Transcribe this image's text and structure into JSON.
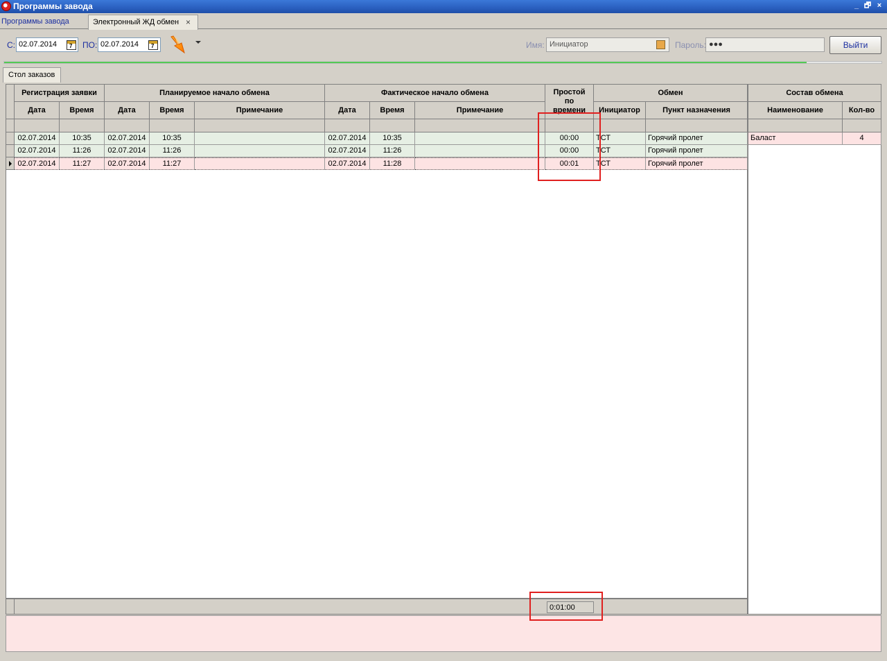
{
  "window": {
    "title": "Программы завода",
    "controls": [
      "_",
      "🗗",
      "×"
    ]
  },
  "tabs": {
    "tab1": "Программы завода",
    "tab2": "Электронный ЖД обмен",
    "tab2_close": "×"
  },
  "filter": {
    "from_label": "С:",
    "from_value": "02.07.2014",
    "to_label": "ПО:",
    "to_value": "02.07.2014",
    "cal_icon_digit": "7",
    "name_label": "Имя:",
    "name_value": "Инициатор",
    "password_label": "Пароль:",
    "password_value": "●●●",
    "exit_button": "Выйти"
  },
  "progress": {
    "fraction": 0.915
  },
  "inner_tab": "Стол заказов",
  "grid": {
    "groups": {
      "registration": "Регистрация заявки",
      "planned": "Планируемое начало обмена",
      "actual": "Фактическое начало обмена",
      "idle": "Простой по времени",
      "exchange": "Обмен",
      "composition": "Состав обмена"
    },
    "columns": {
      "date": "Дата",
      "time": "Время",
      "note": "Примечание",
      "initiator": "Инициатор",
      "destination": "Пункт назначения",
      "name": "Наименование",
      "qty": "Кол-во"
    },
    "rows": [
      {
        "reg_date": "02.07.2014",
        "reg_time": "10:35",
        "plan_date": "02.07.2014",
        "plan_time": "10:35",
        "plan_note": "",
        "act_date": "02.07.2014",
        "act_time": "10:35",
        "act_note": "",
        "idle": "00:00",
        "initiator": "ТСТ",
        "destination": "Горячий пролет"
      },
      {
        "reg_date": "02.07.2014",
        "reg_time": "11:26",
        "plan_date": "02.07.2014",
        "plan_time": "11:26",
        "plan_note": "",
        "act_date": "02.07.2014",
        "act_time": "11:26",
        "act_note": "",
        "idle": "00:00",
        "initiator": "ТСТ",
        "destination": "Горячий пролет"
      },
      {
        "reg_date": "02.07.2014",
        "reg_time": "11:27",
        "plan_date": "02.07.2014",
        "plan_time": "11:27",
        "plan_note": "",
        "act_date": "02.07.2014",
        "act_time": "11:28",
        "act_note": "",
        "idle": "00:01",
        "initiator": "ТСТ",
        "destination": "Горячий пролет"
      }
    ],
    "composition_rows": [
      {
        "name": "Баласт",
        "qty": "4"
      }
    ],
    "footer_total": "0:01:00"
  },
  "colors": {
    "row_normal": "#e6efe4",
    "row_selected": "#fde3e3",
    "annotation_red": "#e0201f",
    "progress_green": "#2db52d"
  }
}
